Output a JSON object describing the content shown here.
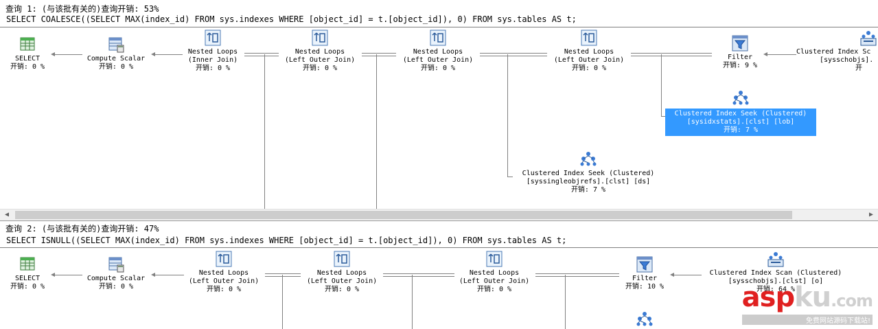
{
  "query1": {
    "header": "查询 1: (与该批有关的)查询开销: 53%",
    "sql": "SELECT COALESCE((SELECT MAX(index_id) FROM sys.indexes WHERE [object_id] = t.[object_id]), 0) FROM sys.tables AS t;",
    "nodes": {
      "select": {
        "l1": "SELECT",
        "l2": "开销: 0 %"
      },
      "compute": {
        "l1": "Compute Scalar",
        "l2": "开销: 0 %"
      },
      "nl1": {
        "l1": "Nested Loops",
        "l2": "(Inner Join)",
        "l3": "开销: 0 %"
      },
      "nl2": {
        "l1": "Nested Loops",
        "l2": "(Left Outer Join)",
        "l3": "开销: 0 %"
      },
      "nl3": {
        "l1": "Nested Loops",
        "l2": "(Left Outer Join)",
        "l3": "开销: 0 %"
      },
      "nl4": {
        "l1": "Nested Loops",
        "l2": "(Left Outer Join)",
        "l3": "开销: 0 %"
      },
      "filter": {
        "l1": "Filter",
        "l2": "开销: 9 %"
      },
      "cis": {
        "l1": "Clustered Index Sc",
        "l2": "[sysschobjs].",
        "l3": "开"
      },
      "seek1": {
        "l1": "Clustered Index Seek (Clustered)",
        "l2": "[sysidxstats].[clst] [lob]",
        "l3": "开销: 7 %"
      },
      "seek2": {
        "l1": "Clustered Index Seek (Clustered)",
        "l2": "[syssingleobjrefs].[clst] [ds]",
        "l3": "开销: 7 %"
      }
    }
  },
  "query2": {
    "header": "查询 2: (与该批有关的)查询开销: 47%",
    "sql": "SELECT ISNULL((SELECT MAX(index_id) FROM sys.indexes WHERE [object_id] = t.[object_id]), 0) FROM sys.tables AS t;",
    "nodes": {
      "select": {
        "l1": "SELECT",
        "l2": "开销: 0 %"
      },
      "compute": {
        "l1": "Compute Scalar",
        "l2": "开销: 0 %"
      },
      "nl1": {
        "l1": "Nested Loops",
        "l2": "(Left Outer Join)",
        "l3": "开销: 0 %"
      },
      "nl2": {
        "l1": "Nested Loops",
        "l2": "(Left Outer Join)",
        "l3": "开销: 0 %"
      },
      "nl3": {
        "l1": "Nested Loops",
        "l2": "(Left Outer Join)",
        "l3": "开销: 0 %"
      },
      "filter": {
        "l1": "Filter",
        "l2": "开销: 10 %"
      },
      "cis": {
        "l1": "Clustered Index Scan (Clustered)",
        "l2": "[sysschobjs].[clst] [o]",
        "l3": "开销: 64 %"
      }
    }
  },
  "watermark": {
    "logo_a": "asp",
    "logo_b": "ku",
    "logo_c": ".com",
    "sub": "免费网站源码下载站!"
  }
}
